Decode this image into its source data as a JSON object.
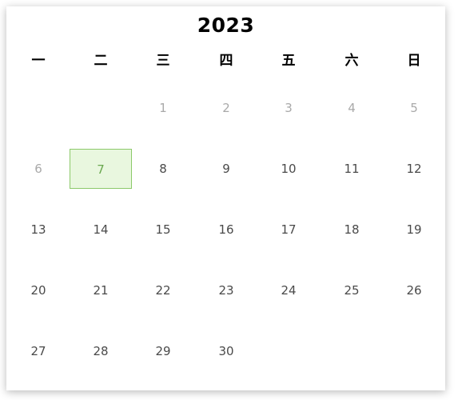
{
  "calendar": {
    "year": "2023",
    "weekdays": [
      "一",
      "二",
      "三",
      "四",
      "五",
      "六",
      "日"
    ],
    "days": [
      {
        "label": "1",
        "col": 2,
        "row": 0,
        "muted": true
      },
      {
        "label": "2",
        "col": 3,
        "row": 0,
        "muted": true
      },
      {
        "label": "3",
        "col": 4,
        "row": 0,
        "muted": true
      },
      {
        "label": "4",
        "col": 5,
        "row": 0,
        "muted": true
      },
      {
        "label": "5",
        "col": 6,
        "row": 0,
        "muted": true
      },
      {
        "label": "6",
        "col": 0,
        "row": 1,
        "muted": true
      },
      {
        "label": "7",
        "col": 1,
        "row": 1,
        "selected": true
      },
      {
        "label": "8",
        "col": 2,
        "row": 1
      },
      {
        "label": "9",
        "col": 3,
        "row": 1
      },
      {
        "label": "10",
        "col": 4,
        "row": 1
      },
      {
        "label": "11",
        "col": 5,
        "row": 1
      },
      {
        "label": "12",
        "col": 6,
        "row": 1
      },
      {
        "label": "13",
        "col": 0,
        "row": 2
      },
      {
        "label": "14",
        "col": 1,
        "row": 2
      },
      {
        "label": "15",
        "col": 2,
        "row": 2
      },
      {
        "label": "16",
        "col": 3,
        "row": 2
      },
      {
        "label": "17",
        "col": 4,
        "row": 2
      },
      {
        "label": "18",
        "col": 5,
        "row": 2
      },
      {
        "label": "19",
        "col": 6,
        "row": 2
      },
      {
        "label": "20",
        "col": 0,
        "row": 3
      },
      {
        "label": "21",
        "col": 1,
        "row": 3
      },
      {
        "label": "22",
        "col": 2,
        "row": 3
      },
      {
        "label": "23",
        "col": 3,
        "row": 3
      },
      {
        "label": "24",
        "col": 4,
        "row": 3
      },
      {
        "label": "25",
        "col": 5,
        "row": 3
      },
      {
        "label": "26",
        "col": 6,
        "row": 3
      },
      {
        "label": "27",
        "col": 0,
        "row": 4
      },
      {
        "label": "28",
        "col": 1,
        "row": 4
      },
      {
        "label": "29",
        "col": 2,
        "row": 4
      },
      {
        "label": "30",
        "col": 3,
        "row": 4
      }
    ],
    "colors": {
      "selected_bg": "#e9f7df",
      "selected_border": "#8cc96a",
      "selected_text": "#6aa84f",
      "muted_text": "#a9a9a9",
      "day_text": "#4a4a4a"
    }
  }
}
